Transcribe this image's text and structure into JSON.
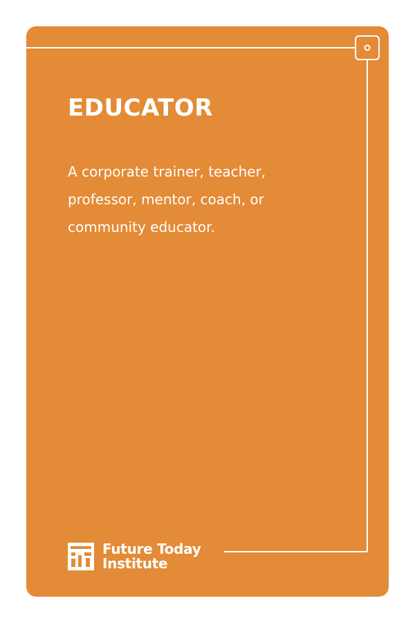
{
  "colors": {
    "card_background": "#E38B37",
    "foreground": "#FFFFFF",
    "page_background": "#FFFFFF"
  },
  "card": {
    "title": "EDUCATOR",
    "description": "A corporate trainer, teacher, professor, mentor, coach, or community educator."
  },
  "branding": {
    "logo_icon": "future-today-institute-logo-icon",
    "name_line_1": "Future Today",
    "name_line_2": "Institute"
  }
}
